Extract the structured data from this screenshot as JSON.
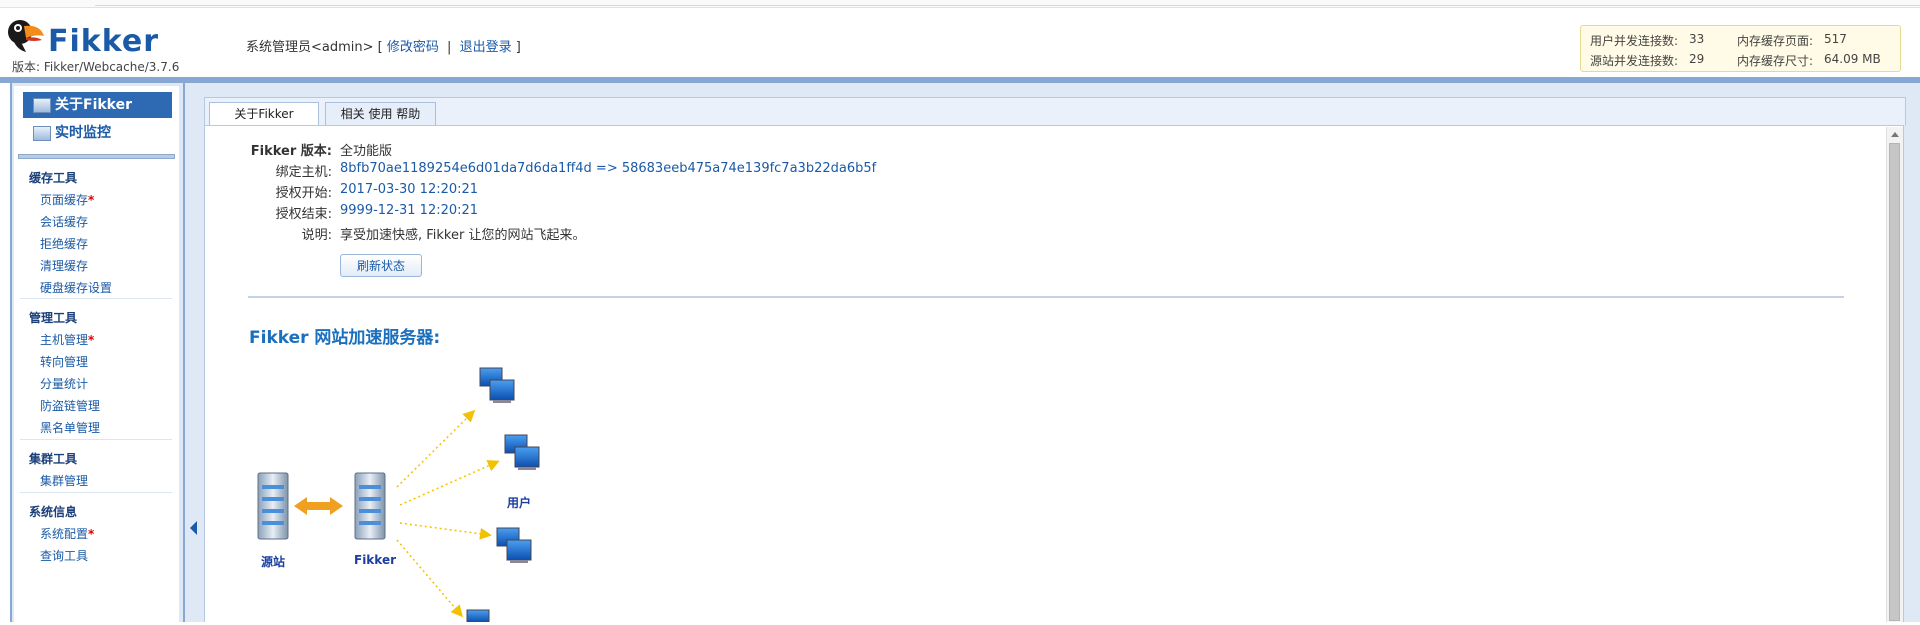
{
  "header": {
    "brand": "Fikker",
    "version_text": "版本: Fikker/Webcache/3.7.6",
    "user_label": "系统管理员<admin>",
    "bracket_open": "[",
    "change_password": "修改密码",
    "separator": "|",
    "logout": "退出登录",
    "bracket_close": "]"
  },
  "stats": {
    "user_conn_label": "用户并发连接数:",
    "user_conn_value": "33",
    "mem_pages_label": "内存缓存页面:",
    "mem_pages_value": "517",
    "origin_conn_label": "源站并发连接数:",
    "origin_conn_value": "29",
    "mem_size_label": "内存缓存尺寸:",
    "mem_size_value": "64.09 MB"
  },
  "sidebar": {
    "main_nav": [
      {
        "label": "关于Fikker",
        "icon": "about-icon"
      },
      {
        "label": "实时监控",
        "icon": "monitor-icon"
      }
    ],
    "groups": [
      {
        "title": "缓存工具",
        "items": [
          {
            "label": "页面缓存",
            "star": "*"
          },
          {
            "label": "会话缓存",
            "star": ""
          },
          {
            "label": "拒绝缓存",
            "star": ""
          },
          {
            "label": "清理缓存",
            "star": ""
          },
          {
            "label": "硬盘缓存设置",
            "star": ""
          }
        ]
      },
      {
        "title": "管理工具",
        "items": [
          {
            "label": "主机管理",
            "star": "*"
          },
          {
            "label": "转向管理",
            "star": ""
          },
          {
            "label": "分量统计",
            "star": ""
          },
          {
            "label": "防盗链管理",
            "star": ""
          },
          {
            "label": "黑名单管理",
            "star": ""
          }
        ]
      },
      {
        "title": "集群工具",
        "items": [
          {
            "label": "集群管理",
            "star": ""
          }
        ]
      },
      {
        "title": "系统信息",
        "items": [
          {
            "label": "系统配置",
            "star": "*"
          },
          {
            "label": "查询工具",
            "star": ""
          }
        ]
      }
    ]
  },
  "tabs": [
    {
      "label": "关于Fikker",
      "active": true
    },
    {
      "label": "相关 使用 帮助",
      "active": false
    }
  ],
  "info": {
    "version_label": "Fikker 版本:",
    "version_value": "全功能版",
    "host_label": "绑定主机:",
    "host_value": "8bfb70ae1189254e6d01da7d6da1ff4d => 58683eeb475a74e139fc7a3b22da6b5f",
    "start_label": "授权开始:",
    "start_value": "2017-03-30 12:20:21",
    "end_label": "授权结束:",
    "end_value": "9999-12-31 12:20:21",
    "desc_label": "说明:",
    "desc_value": "享受加速快感, Fikker 让您的网站飞起来。",
    "refresh_button": "刷新状态"
  },
  "diagram": {
    "title": "Fikker 网站加速服务器:",
    "origin_label": "源站",
    "fikker_label": "Fikker",
    "users_label": "用户"
  },
  "colors": {
    "brand_blue": "#1a5aa6",
    "frame_blue": "#86a8d3",
    "active_nav": "#2d6ab3",
    "arrow_orange": "#f0a020",
    "dash_yellow": "#f2c200"
  }
}
